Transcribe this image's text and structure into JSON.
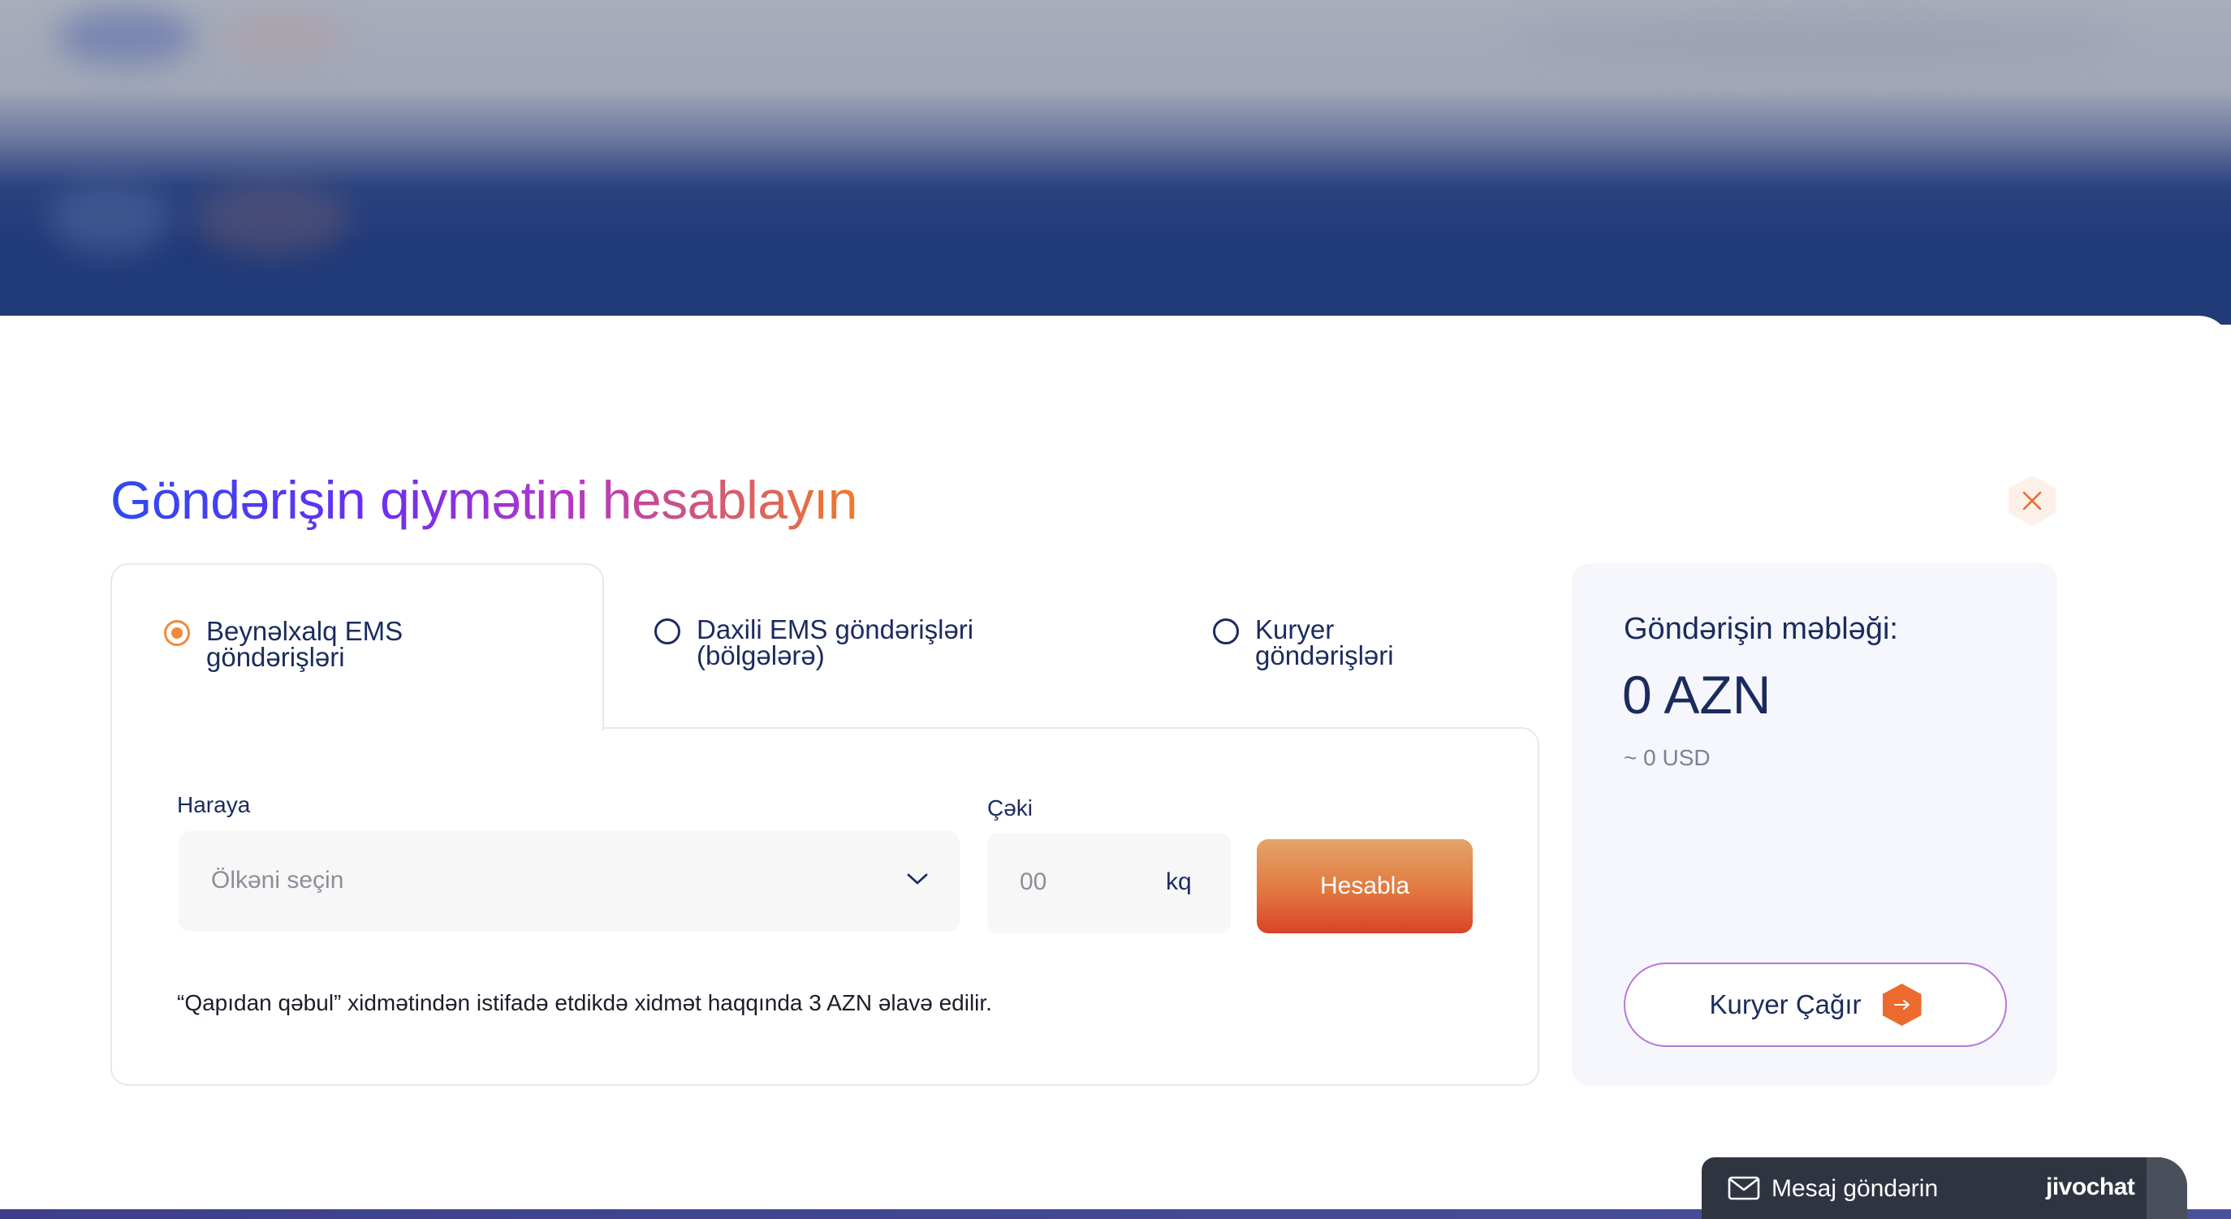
{
  "calculator": {
    "title": "Göndərişin qiymətini hesablayın",
    "close_icon": "close-icon",
    "tabs": [
      {
        "label": "Beynəlxalq EMS göndərişləri",
        "selected": true
      },
      {
        "label": "Daxili EMS göndərişləri (bölgələrə)",
        "selected": false
      },
      {
        "label": "Kuryer göndərişləri",
        "selected": false
      }
    ],
    "form": {
      "destination_label": "Haraya",
      "destination_placeholder": "Ölkəni seçin",
      "weight_label": "Çəki",
      "weight_placeholder": "00",
      "weight_unit": "kq",
      "calculate_label": "Hesabla",
      "note": "“Qapıdan qəbul” xidmətindən istifadə etdikdə xidmət haqqında 3 AZN əlavə edilir."
    },
    "summary": {
      "label": "Göndərişin məbləği:",
      "amount": "0 AZN",
      "usd": "~ 0 USD",
      "courier_button": "Kuryer Çağır"
    }
  },
  "chat": {
    "label": "Mesaj göndərin",
    "brand": "jivochat"
  },
  "colors": {
    "accent_orange": "#f08a3a",
    "navy_text": "#1b2b5e",
    "header_blue": "#213a78",
    "title_gradient": [
      "#2b4bf0",
      "#6a2ff0",
      "#b235c8",
      "#f07a2a"
    ]
  }
}
